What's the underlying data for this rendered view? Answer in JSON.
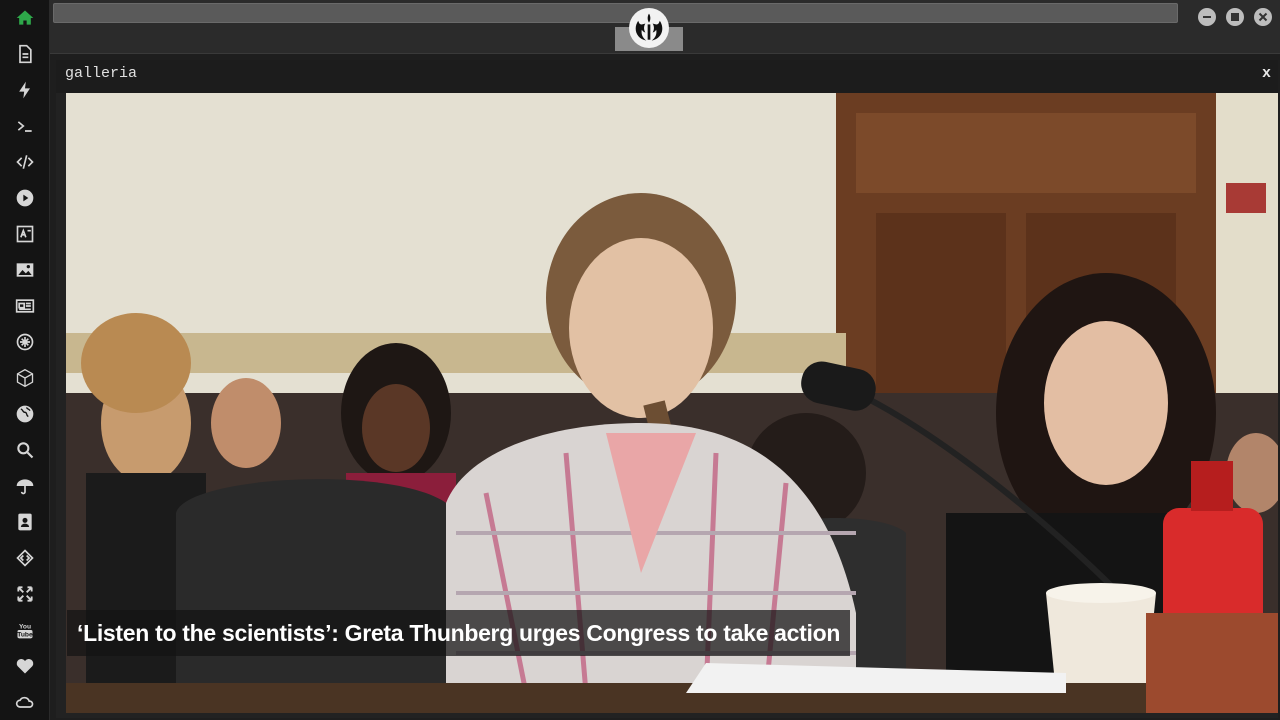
{
  "app": {
    "sidebar_icons": [
      "home-icon",
      "document-icon",
      "lightning-icon",
      "terminal-icon",
      "code-icon",
      "play-icon",
      "translate-icon",
      "image-icon",
      "newspaper-icon",
      "gear-icon",
      "cube-icon",
      "globe-icon",
      "search-icon",
      "umbrella-icon",
      "contact-card-icon",
      "diamond-code-icon",
      "expand-icon",
      "youtube-icon",
      "heart-icon",
      "cloud-icon"
    ],
    "logo_icon": "rebel-alliance-icon",
    "window_controls": [
      "minimize-icon",
      "maximize-icon",
      "close-icon"
    ]
  },
  "panel": {
    "title": "galleria",
    "close_label": "x"
  },
  "gallery": {
    "caption": "‘Listen to the scientists’: Greta Thunberg urges Congress to take action"
  },
  "colors": {
    "accent_home": "#2ea84a",
    "sidebar_bg": "#141414",
    "icon": "#d6d6d6"
  }
}
